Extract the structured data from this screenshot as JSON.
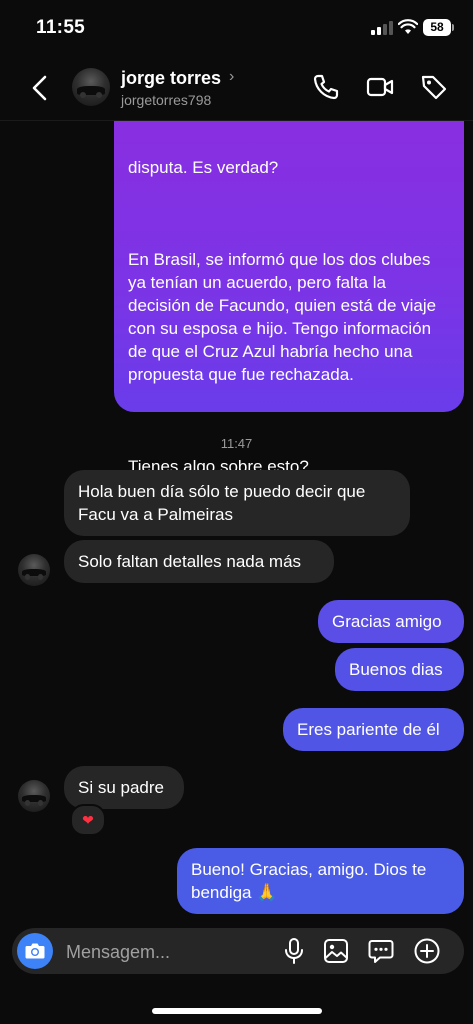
{
  "status_bar": {
    "time": "11:55",
    "battery": "58"
  },
  "header": {
    "contact_name": "jorge torres",
    "chevron": "›",
    "username": "jorgetorres798",
    "icons": [
      "back-icon",
      "phone-icon",
      "video-icon",
      "tag-icon"
    ]
  },
  "messages": {
    "outgoing_long": {
      "line0": "disputa. Es verdad?",
      "para1": "En Brasil, se informó que los dos clubes ya tenían un acuerdo, pero falta la decisión de Facundo, quien está de viaje con su esposa e hijo. Tengo información de que el Cruz Azul habría hecho una propuesta que fue rechazada.",
      "para2": "Tienes algo sobre esto?\nGracias y saludos desde Brasil."
    },
    "timestamp": "11:47",
    "in1": "Hola buen día sólo te puedo decir que Facu va a Palmeiras",
    "in2": "Solo faltan detalles nada más",
    "out1": "Gracias amigo",
    "out2": "Buenos dias",
    "out3": "Eres pariente de él",
    "in3": "Si su padre",
    "reaction": "❤",
    "out4": "Bueno! Gracias, amigo. Dios te bendiga 🙏"
  },
  "composer": {
    "placeholder": "Mensagem...",
    "icons": [
      "camera-icon",
      "microphone-icon",
      "gallery-icon",
      "sticker-icon",
      "add-icon"
    ]
  },
  "colors": {
    "background": "#0b0b0b",
    "incoming_bubble": "#262626",
    "outgoing_purple": "#8a2ee0",
    "outgoing_blue": "#5055e6",
    "camera_button": "#3d82f6",
    "reaction_heart": "#ff3040"
  }
}
